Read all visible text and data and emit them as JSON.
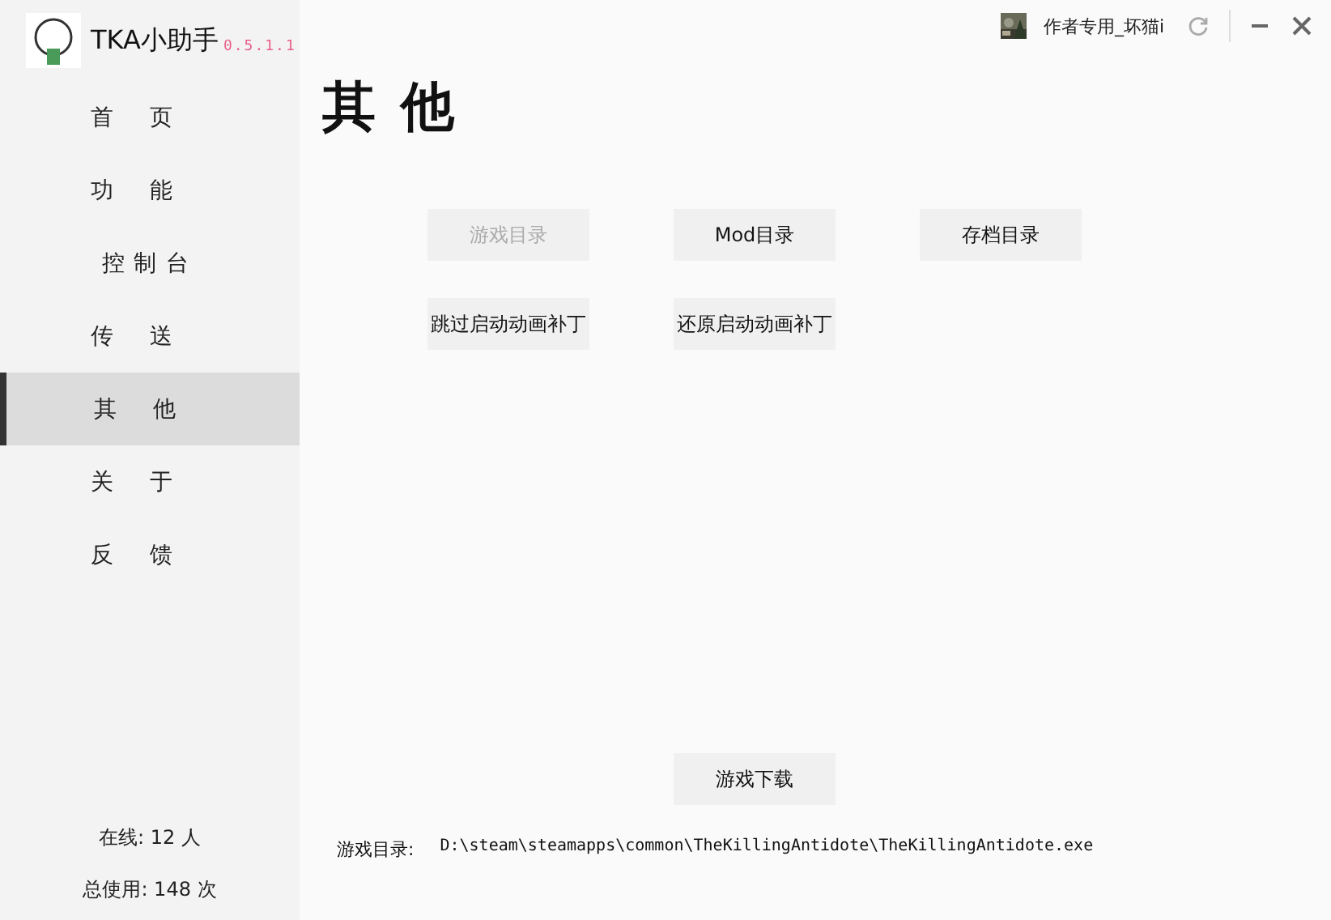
{
  "app": {
    "name": "TKA小助手",
    "version": "0.5.1.1"
  },
  "user": {
    "name": "作者专用_坏猫i"
  },
  "nav": [
    {
      "label": "首页",
      "selected": false
    },
    {
      "label": "功能",
      "selected": false
    },
    {
      "label": "控制台",
      "selected": false
    },
    {
      "label": "传送",
      "selected": false
    },
    {
      "label": "其他",
      "selected": true
    },
    {
      "label": "关于",
      "selected": false
    },
    {
      "label": "反馈",
      "selected": false
    }
  ],
  "stats": [
    "在线: 12 人",
    "总使用: 148 次"
  ],
  "page_title": "其 他",
  "buttons": [
    {
      "label": "游戏目录",
      "disabled": true
    },
    {
      "label": "Mod目录",
      "disabled": false
    },
    {
      "label": "存档目录",
      "disabled": false
    },
    {
      "label": "跳过启动动画补丁",
      "disabled": false
    },
    {
      "label": "还原启动动画补丁",
      "disabled": false
    }
  ],
  "download_button": "游戏下载",
  "game_path": {
    "label": "游戏目录:",
    "value": "D:\\steam\\steamapps\\common\\TheKillingAntidote\\TheKillingAntidote.exe"
  }
}
